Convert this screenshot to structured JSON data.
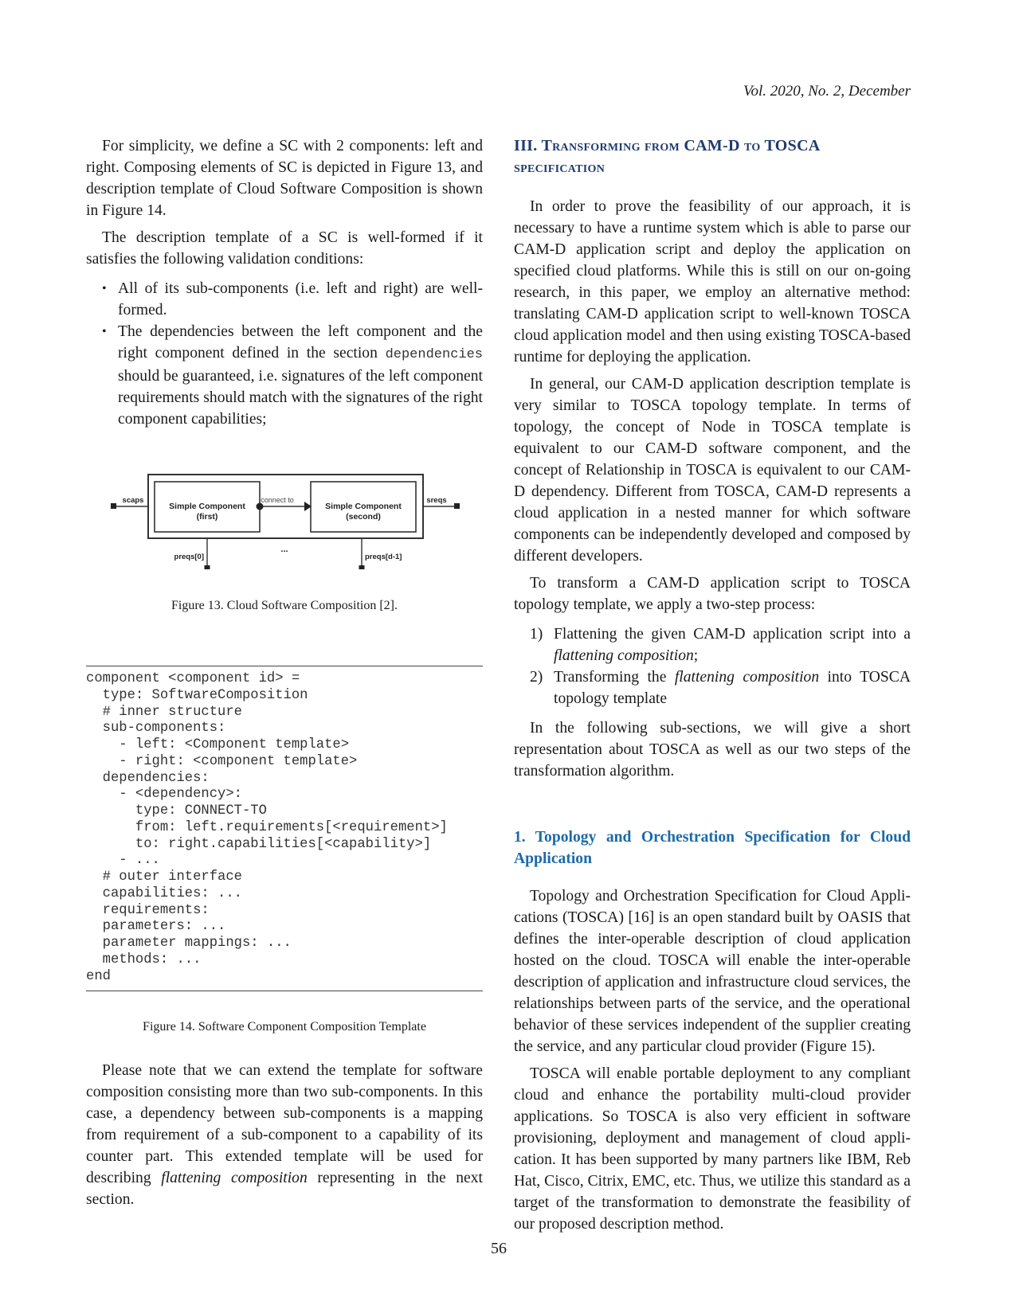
{
  "header": {
    "running_head": "Vol. 2020, No. 2, December"
  },
  "left_column": {
    "paragraphs_top": [
      "For simplicity, we define a SC with 2 components: left and right. Composing elements of SC is depicted in Figure 13, and description template of Cloud Software Composition is shown in Figure 14.",
      "The description template of a SC is well-formed if it satisfies the following validation conditions:"
    ],
    "bullets": [
      {
        "text": "All of its sub-components (i.e. left and right) are well-formed."
      },
      {
        "text_before": "The dependencies between the left component and the right component defined in the section ",
        "code": "dependencies",
        "text_after": " should be guaranteed, i.e. signatures of the left component requirements should match with the signatures of the right component capabilities;"
      }
    ],
    "figure13": {
      "caption": "Figure 13.  Cloud Software Composition [2].",
      "first_component": {
        "title": "Simple Component",
        "subtitle": "(first)"
      },
      "second_component": {
        "title": "Simple Component",
        "subtitle": "(second)"
      },
      "connector_label": "connect to",
      "left_port_label": "scaps",
      "right_port_label": "sreqs",
      "bottom_left_port_label": "preqs[0]",
      "bottom_right_port_label": "preqs[d-1]",
      "ellipsis": "..."
    },
    "figure14": {
      "caption": "Figure 14.  Software Component Composition Template",
      "code_lines": [
        "component <component id> =",
        "  type: SoftwareComposition",
        "  # inner structure",
        "  sub-components:",
        "    - left: <Component template>",
        "    - right: <component template>",
        "  dependencies:",
        "    - <dependency>:",
        "      type: CONNECT-TO",
        "      from: left.requirements[<requirement>]",
        "      to: right.capabilities[<capability>]",
        "    - ...",
        "  # outer interface",
        "  capabilities: ...",
        "  requirements:",
        "  parameters: ...",
        "  parameter mappings: ...",
        "  methods: ...",
        "end"
      ]
    },
    "closing_paragraph": {
      "before": "Please note that we can extend the template for software composition consisting more than two sub-components. In this case, a dependency between sub-components is a mapping from requirement of a sub-component to a capability of its counter part. This extended template will be used for describing ",
      "em": "flattening composition",
      "after": " representing in the next section."
    }
  },
  "right_column": {
    "section_heading": "III. Transforming from CAM-D to TOSCA specification",
    "paragraphs": [
      "In order to prove the feasibility of our approach, it is necessary to have a runtime system which is able to parse our CAM-D application script and deploy the application on specified cloud platforms. While this is still on our on-going research, in this paper, we employ an alternative method: translating CAM-D application script to well-known TOSCA cloud application model and then using existing TOSCA-based runtime for deploying the application.",
      "In general, our CAM-D application description template is very similar to TOSCA topology template. In terms of topology, the concept of Node in TOSCA template is equivalent to our CAM-D software component, and the concept of Relationship in TOSCA is equivalent to our CAM-D dependency. Different from TOSCA, CAM-D represents a cloud application in a nested manner for which software components can be independently developed and composed by different developers.",
      "To transform a CAM-D application script to TOSCA topology template, we apply a two-step process:"
    ],
    "steps": [
      {
        "num": "1)",
        "before": "Flattening the given CAM-D application script into a ",
        "em": "flattening composition",
        "after": ";"
      },
      {
        "num": "2)",
        "before": "Transforming the ",
        "em": "flattening composition",
        "after": " into TOSCA topology template"
      }
    ],
    "after_steps_paragraph": "In the following sub-sections, we will give a short representation about TOSCA as well as our two steps of the transformation algorithm.",
    "subsection_heading": "1. Topology and Orchestration Specification for Cloud Application",
    "subsection_paragraphs": [
      "Topology and Orchestration Specification for Cloud Appli-cations (TOSCA) [16] is an open standard built by OASIS that defines the inter-operable description of cloud application hosted on the cloud. TOSCA will enable the inter-operable description of application and infrastructure cloud services, the relationships between parts of the service, and the operational behavior of these services independent of the supplier creating the service, and any particular cloud provider (Figure 15).",
      "TOSCA will enable portable deployment to any compliant cloud and enhance the portability multi-cloud provider applications. So TOSCA is also very efficient in software provisioning, deployment and management of cloud appli-cation. It has been supported by many partners like IBM, Reb Hat, Cisco, Citrix, EMC, etc. Thus, we utilize this standard as a target of the transformation to demonstrate the feasibility of our proposed description method."
    ]
  },
  "footer": {
    "page_number": "56"
  },
  "colors": {
    "section_heading": "#1f3a6e",
    "subsection_heading": "#1c6aa8",
    "text": "#1a1a1a"
  }
}
